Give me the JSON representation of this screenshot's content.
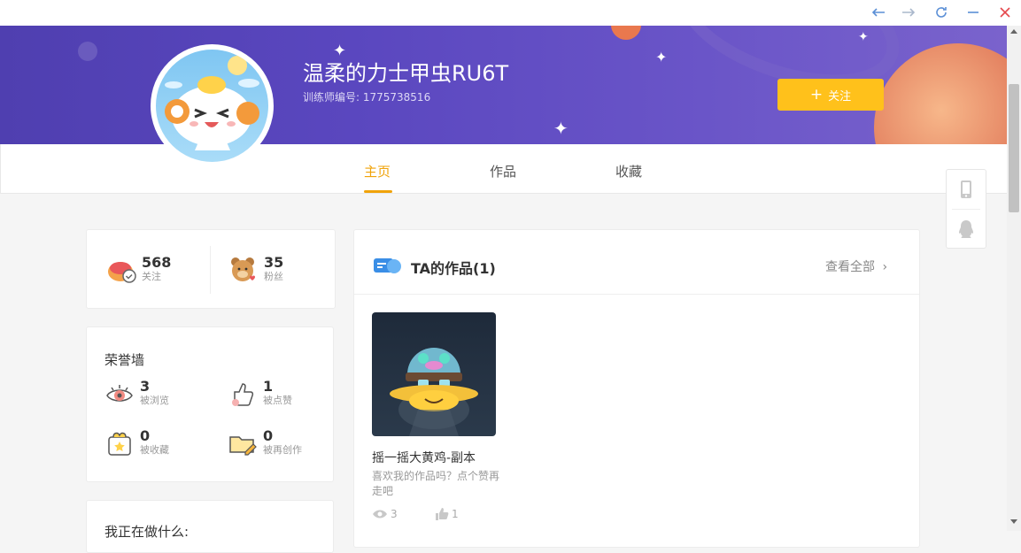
{
  "window": {
    "back_icon": "arrow-left-icon",
    "forward_icon": "arrow-right-icon",
    "refresh_icon": "refresh-icon",
    "minimize_icon": "minimize-icon",
    "close_icon": "close-icon"
  },
  "profile": {
    "username": "温柔的力士甲虫RU6T",
    "trainer_id": "训练师编号: 1775738516",
    "follow_label": "关注",
    "follow_icon": "plus-icon"
  },
  "tabs": [
    {
      "label": "主页",
      "active": true
    },
    {
      "label": "作品",
      "active": false
    },
    {
      "label": "收藏",
      "active": false
    }
  ],
  "social": {
    "following_count": "568",
    "following_label": "关注",
    "fans_count": "35",
    "fans_label": "粉丝"
  },
  "honor": {
    "title": "荣誉墙",
    "views_count": "3",
    "views_label": "被浏览",
    "likes_count": "1",
    "likes_label": "被点赞",
    "favs_count": "0",
    "favs_label": "被收藏",
    "remix_count": "0",
    "remix_label": "被再创作"
  },
  "doing": {
    "title": "我正在做什么:"
  },
  "works": {
    "title": "TA的作品(1)",
    "see_all": "查看全部",
    "items": [
      {
        "title": "摇一摇大黄鸡-副本",
        "desc": "喜欢我的作品吗？点个赞再走吧",
        "views": "3",
        "likes": "1"
      }
    ]
  },
  "colors": {
    "accent": "#f0a30a",
    "follow_button": "#ffc11b",
    "banner": "#5a47bf"
  }
}
